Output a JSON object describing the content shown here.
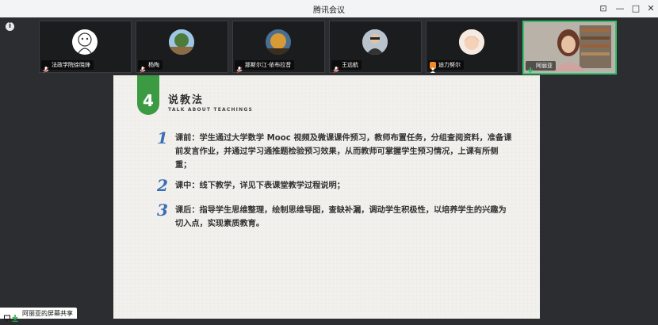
{
  "window": {
    "title": "腾讯会议",
    "minimize_glyph": "—",
    "maximize_glyph": "□",
    "close_glyph": "✕",
    "pin_glyph": "⊡"
  },
  "strip": {
    "info_glyph": "i",
    "participants": [
      {
        "name": "法政学院徐晓烽"
      },
      {
        "name": "杨陶"
      },
      {
        "name": "那斯尔江·依布拉音"
      },
      {
        "name": "王远航"
      },
      {
        "name": "迪力努尔"
      },
      {
        "name": "阿丽亚"
      }
    ]
  },
  "slide": {
    "number": "4",
    "title": "说教法",
    "subtitle": "TALK ABOUT TEACHINGS",
    "items": [
      {
        "num": "1",
        "text": "课前：学生通过大学数学 Mooc 视频及微课课件预习，教师布置任务，分组查阅资料，准备课前发言作业，并通过学习通推题检验预习效果，从而教师可掌握学生预习情况，上课有所侧重；"
      },
      {
        "num": "2",
        "text": "课中：线下教学，详见下表课堂教学过程说明；"
      },
      {
        "num": "3",
        "text": "课后：指导学生思维整理，绘制思维导图，查缺补漏，调动学生积极性，以培养学生的兴趣为切入点，实现素质教育。"
      }
    ]
  },
  "share": {
    "label": "阿丽亚的屏幕共享"
  },
  "colors": {
    "accent_green": "#3c9a43",
    "number_blue": "#3a6fb5",
    "active_border": "#35c16a"
  }
}
